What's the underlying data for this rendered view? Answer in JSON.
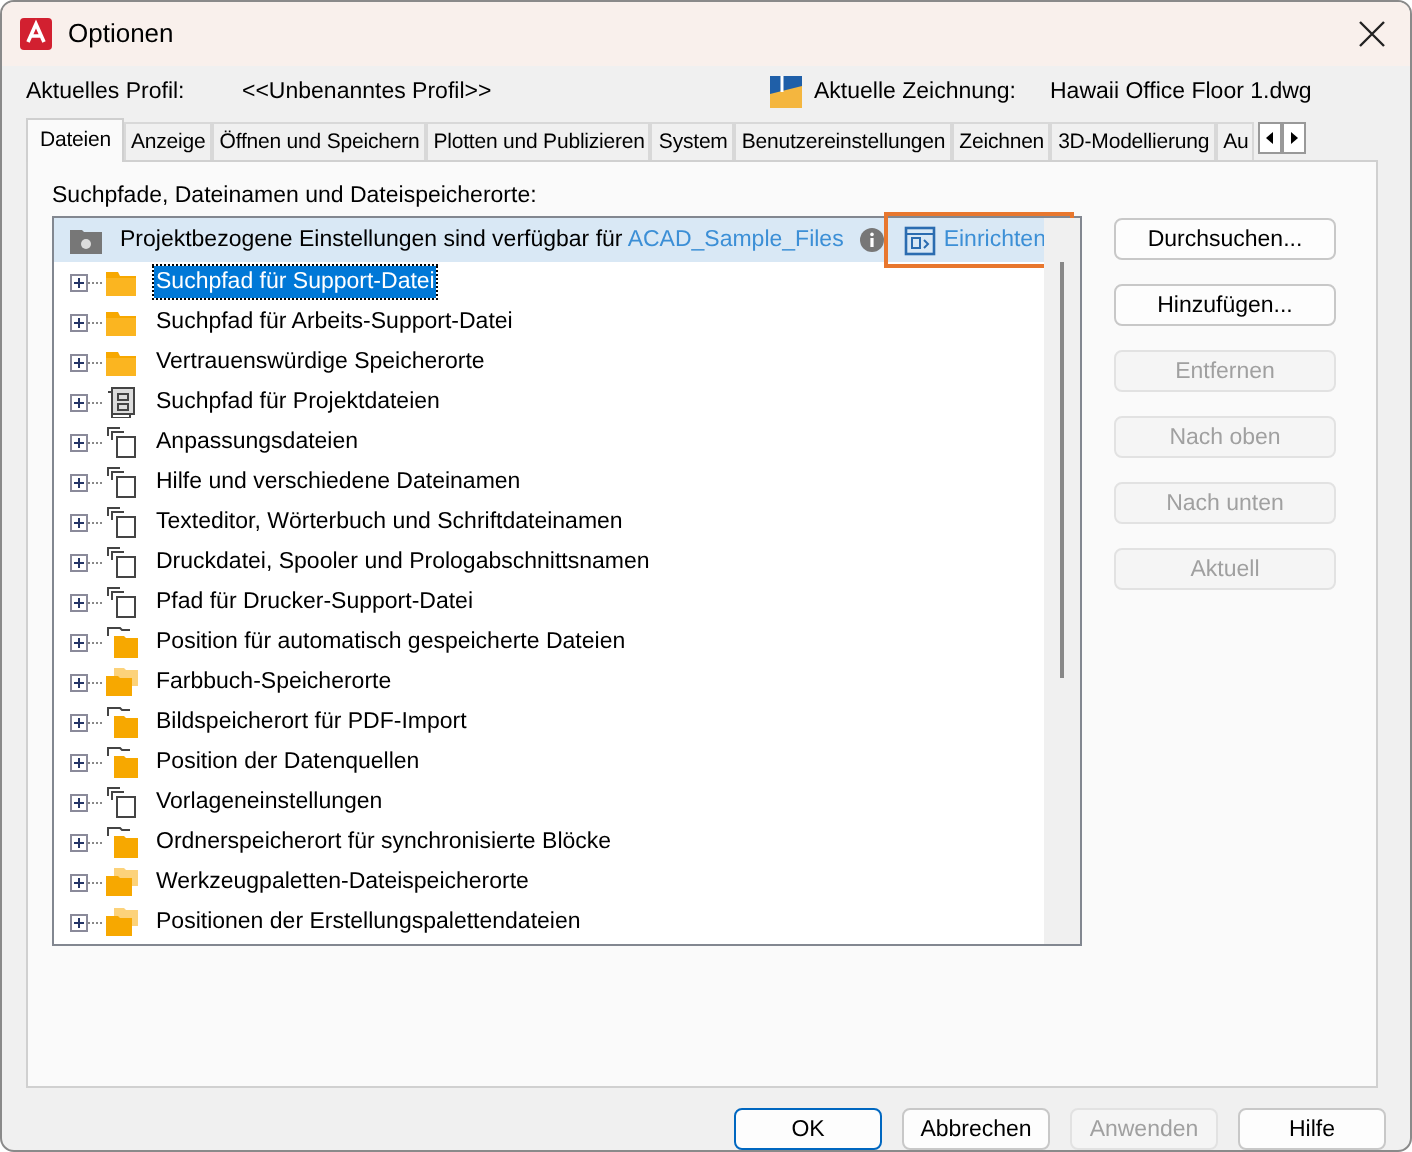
{
  "window": {
    "title": "Optionen"
  },
  "profile": {
    "label": "Aktuelles Profil:",
    "value": "<<Unbenanntes Profil>>",
    "drawing_label": "Aktuelle Zeichnung:",
    "drawing_value": "Hawaii Office Floor 1.dwg"
  },
  "tabs": [
    {
      "label": "Dateien",
      "selected": true
    },
    {
      "label": "Anzeige",
      "selected": false
    },
    {
      "label": "Öffnen und Speichern",
      "selected": false
    },
    {
      "label": "Plotten und Publizieren",
      "selected": false
    },
    {
      "label": "System",
      "selected": false
    },
    {
      "label": "Benutzereinstellungen",
      "selected": false
    },
    {
      "label": "Zeichnen",
      "selected": false
    },
    {
      "label": "3D-Modellierung",
      "selected": false
    },
    {
      "label": "Au",
      "selected": false
    }
  ],
  "section_label": "Suchpfade, Dateinamen und Dateispeicherorte:",
  "project_banner": {
    "text": "Projektbezogene Einstellungen sind verfügbar für",
    "link": "ACAD_Sample_Files",
    "setup_button": "Einrichten",
    "highlighted": true
  },
  "tree": [
    {
      "label": "Suchpfad für Support-Datei",
      "kind": "folder",
      "selected": true
    },
    {
      "label": "Suchpfad für Arbeits-Support-Datei",
      "kind": "folder",
      "selected": false
    },
    {
      "label": "Vertrauenswürdige Speicherorte",
      "kind": "folder",
      "selected": false
    },
    {
      "label": "Suchpfad für Projektdateien",
      "kind": "cabinet",
      "selected": false
    },
    {
      "label": "Anpassungsdateien",
      "kind": "pages",
      "selected": false
    },
    {
      "label": "Hilfe und verschiedene Dateinamen",
      "kind": "pages",
      "selected": false
    },
    {
      "label": "Texteditor, Wörterbuch und Schriftdateinamen",
      "kind": "pages",
      "selected": false
    },
    {
      "label": "Druckdatei, Spooler und Prologabschnittsnamen",
      "kind": "pages",
      "selected": false
    },
    {
      "label": "Pfad für Drucker-Support-Datei",
      "kind": "pages",
      "selected": false
    },
    {
      "label": "Position für automatisch gespeicherte Dateien",
      "kind": "mixed",
      "selected": false
    },
    {
      "label": "Farbbuch-Speicherorte",
      "kind": "folders",
      "selected": false
    },
    {
      "label": "Bildspeicherort für PDF-Import",
      "kind": "mixed",
      "selected": false
    },
    {
      "label": "Position der Datenquellen",
      "kind": "mixed",
      "selected": false
    },
    {
      "label": "Vorlageneinstellungen",
      "kind": "pages",
      "selected": false
    },
    {
      "label": "Ordnerspeicherort für synchronisierte Blöcke",
      "kind": "mixed",
      "selected": false
    },
    {
      "label": "Werkzeugpaletten-Dateispeicherorte",
      "kind": "folders",
      "selected": false
    },
    {
      "label": "Positionen der Erstellungspalettendateien",
      "kind": "folders",
      "selected": false
    }
  ],
  "side_buttons": [
    {
      "label": "Durchsuchen...",
      "disabled": false
    },
    {
      "label": "Hinzufügen...",
      "disabled": false
    },
    {
      "label": "Entfernen",
      "disabled": true
    },
    {
      "label": "Nach oben",
      "disabled": true
    },
    {
      "label": "Nach unten",
      "disabled": true
    },
    {
      "label": "Aktuell",
      "disabled": true
    }
  ],
  "footer_buttons": [
    {
      "label": "OK",
      "disabled": false,
      "default": true
    },
    {
      "label": "Abbrechen",
      "disabled": false,
      "default": false
    },
    {
      "label": "Anwenden",
      "disabled": true,
      "default": false
    },
    {
      "label": "Hilfe",
      "disabled": false,
      "default": false
    }
  ]
}
